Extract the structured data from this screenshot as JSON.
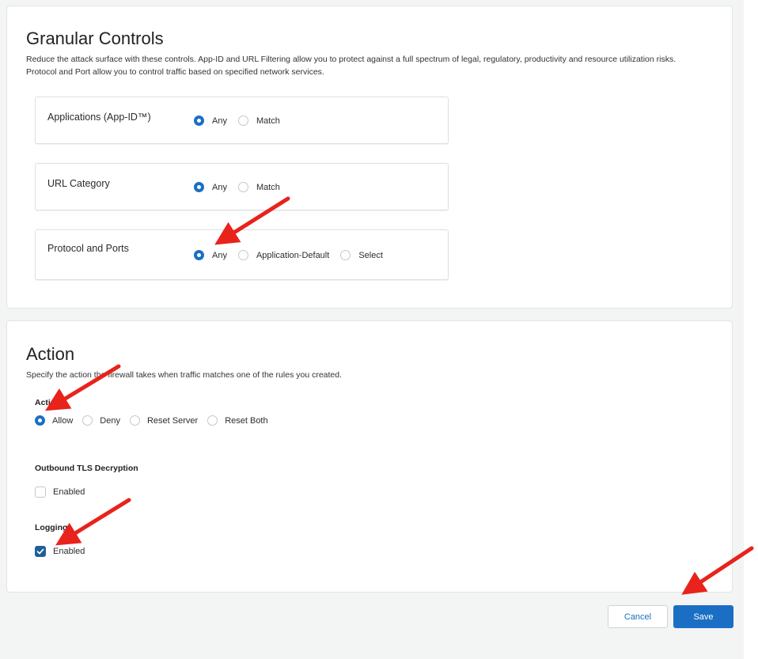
{
  "granular": {
    "title": "Granular Controls",
    "description": "Reduce the attack surface with these controls. App-ID and URL Filtering allow you to protect against a full spectrum of legal, regulatory, productivity and resource utilization risks. Protocol and Port allow you to control traffic based on specified network services.",
    "rows": [
      {
        "label": "Applications (App-ID™)",
        "options": [
          "Any",
          "Match"
        ],
        "selected": "Any"
      },
      {
        "label": "URL Category",
        "options": [
          "Any",
          "Match"
        ],
        "selected": "Any"
      },
      {
        "label": "Protocol and Ports",
        "options": [
          "Any",
          "Application-Default",
          "Select"
        ],
        "selected": "Any"
      }
    ]
  },
  "action": {
    "title": "Action",
    "description": "Specify the action the firewall takes when traffic matches one of the rules you created.",
    "action_label": "Action",
    "action_options": [
      "Allow",
      "Deny",
      "Reset Server",
      "Reset Both"
    ],
    "action_selected": "Allow",
    "tls_label": "Outbound TLS Decryption",
    "tls_checkbox_label": "Enabled",
    "tls_checked": false,
    "logging_label": "Logging",
    "logging_checkbox_label": "Enabled",
    "logging_checked": true
  },
  "footer": {
    "cancel_label": "Cancel",
    "save_label": "Save"
  },
  "colors": {
    "accent": "#1a6fc4",
    "checkbox": "#1f5f97",
    "annotation_arrow": "#e8231c"
  }
}
